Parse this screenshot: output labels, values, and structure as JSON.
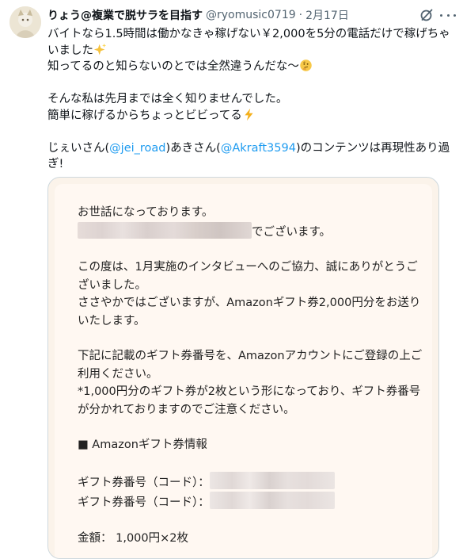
{
  "author": {
    "display_name": "りょう@複業で脱サラを目指す",
    "handle": "@ryomusic0719",
    "separator": "·",
    "date": "2月17日"
  },
  "tweet": {
    "line1": "バイトなら1.5時間は働かなきゃ稼げない￥2,000を5分の電話だけで稼げちゃいました",
    "line2": "知ってるのと知らないのとでは全然違うんだな〜",
    "line3": "そんな私は先月までは全く知りませんでした。",
    "line4": "簡単に稼げるからちょっとビビってる",
    "line5_prefix": "じぇいさん(",
    "mention1": "@jei_road",
    "line5_mid": ")あきさん(",
    "mention2": "@Akraft3594",
    "line5_suffix": ")のコンテンツは再現性あり過ぎ!",
    "emoji1": "sparkles",
    "emoji2": "thinking-face",
    "emoji3": "high-voltage"
  },
  "letter": {
    "greeting": "お世話になっております。",
    "name_suffix": "でございます。",
    "para1": "この度は、1月実施のインタビューへのご協力、誠にありがとうございました。",
    "para2": "ささやかではございますが、Amazonギフト券2,000円分をお送りいたします。",
    "para3": "下記に記載のギフト券番号を、Amazonアカウントにご登録の上ご利用ください。",
    "para4": "*1,000円分のギフト券が2枚という形になっており、ギフト券番号が分かれておりますのでご注意ください。",
    "section_title": "■ Amazonギフト券情報",
    "code_label_1": "ギフト券番号（コード）：",
    "code_label_2": "ギフト券番号（コード）：",
    "amount": "金額： 1,000円×2枚"
  },
  "colors": {
    "link": "#1d9bf0",
    "secondary_text": "#536471",
    "letter_bg": "#fff8f2"
  }
}
